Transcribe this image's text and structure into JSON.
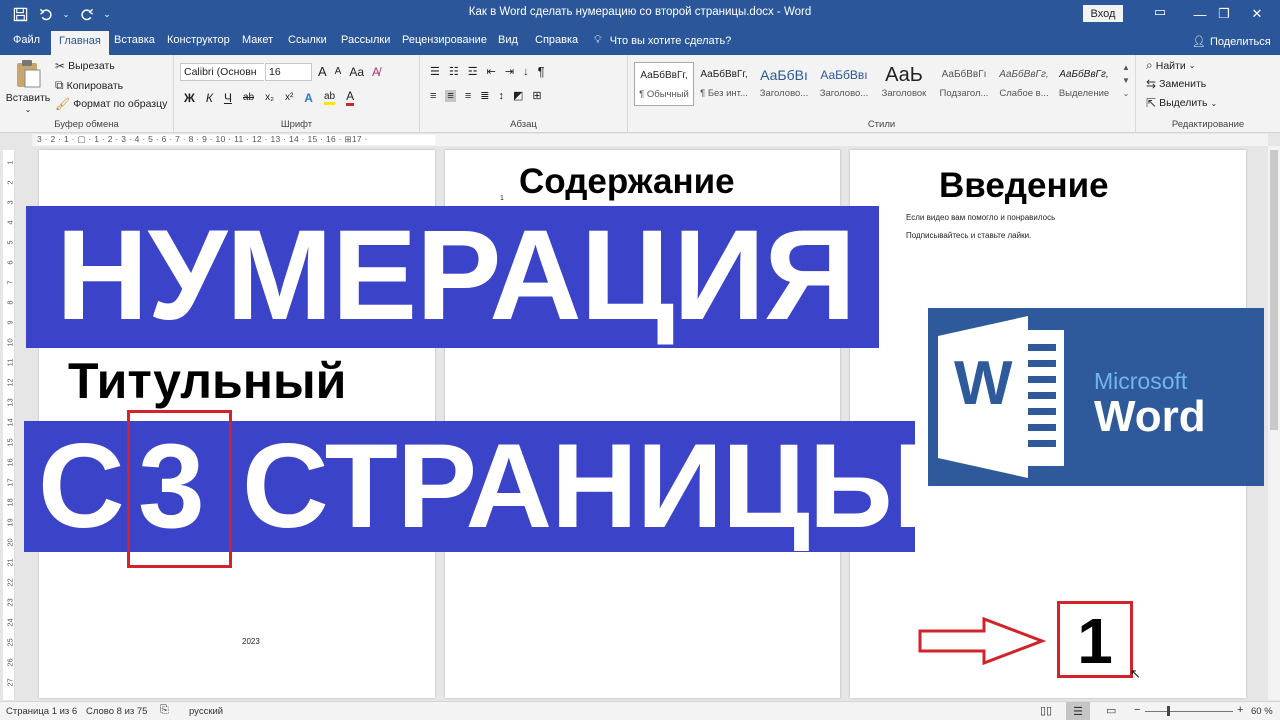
{
  "window": {
    "title": "Как в Word сделать нумерацию со второй страницы.docx  -  Word",
    "signin": "Вход",
    "minimize": "—",
    "restore": "❐",
    "close": "✕"
  },
  "tabs": {
    "items": [
      "Файл",
      "Главная",
      "Вставка",
      "Конструктор",
      "Макет",
      "Ссылки",
      "Рассылки",
      "Рецензирование",
      "Вид",
      "Справка"
    ],
    "tell_me": "Что вы хотите сделать?",
    "share": "Поделиться"
  },
  "ribbon": {
    "clipboard": {
      "paste": "Вставить",
      "cut": "Вырезать",
      "copy": "Копировать",
      "format_painter": "Формат по образцу",
      "label": "Буфер обмена"
    },
    "font": {
      "font_name": "Calibri (Основн",
      "font_size": "16",
      "grow": "A",
      "shrink": "A",
      "case": "Aa",
      "bold": "Ж",
      "italic": "К",
      "underline": "Ч",
      "strike": "ab",
      "subscript": "x₂",
      "superscript": "x²",
      "effects": "A",
      "highlight": "ab",
      "color": "A",
      "label": "Шрифт"
    },
    "paragraph": {
      "label": "Абзац",
      "pilcrow": "¶"
    },
    "styles": {
      "items": [
        {
          "preview": "АаБбВвГг,",
          "name": "¶ Обычный"
        },
        {
          "preview": "АаБбВвГг,",
          "name": "¶ Без инт..."
        },
        {
          "preview": "АаБбВı",
          "name": "Заголово..."
        },
        {
          "preview": "АаБбВвı",
          "name": "Заголово..."
        },
        {
          "preview": "АаЬ",
          "name": "Заголовок"
        },
        {
          "preview": "АаБбВвГı",
          "name": "Подзагол..."
        },
        {
          "preview": "АаБбВвГг,",
          "name": "Слабое в..."
        },
        {
          "preview": "АаБбВвГг,",
          "name": "Выделение"
        }
      ],
      "label": "Стили"
    },
    "editing": {
      "find": "Найти",
      "replace": "Заменить",
      "select": "Выделить",
      "label": "Редактирование"
    }
  },
  "ruler": {
    "horizontal": "3 · 2 · 1 · ▢ · 1 · 2 · 3 · 4 · 5 · 6 · 7 · 8 · 9 · 10 · 11 · 12 · 13 · 14 · 15 · 16 · ⊞17 ·",
    "vertical": [
      "1",
      "2",
      "3",
      "4",
      "5",
      "6",
      "7",
      "8",
      "9",
      "10",
      "11",
      "12",
      "13",
      "14",
      "15",
      "16",
      "17",
      "18",
      "19",
      "20",
      "21",
      "22",
      "23",
      "24",
      "25",
      "26",
      "27"
    ]
  },
  "pages": {
    "page1": {
      "year": "2023"
    },
    "page2": {
      "heading": "Содержание",
      "number": "1"
    },
    "page3": {
      "heading": "Введение",
      "line1": "Если видео вам помогло и понравилось",
      "line2": "Подписывайтесь и ставьте лайки."
    }
  },
  "overlay": {
    "banner1": "НУМЕРАЦИЯ",
    "subheading": "Титульный",
    "banner2_prefix": "С",
    "banner2_number": "3",
    "banner2_suffix": "СТРАНИЦЫ",
    "logo_microsoft": "Microsoft",
    "logo_word": "Word",
    "logo_letter": "W",
    "page_number": "1"
  },
  "status": {
    "page": "Страница 1 из 6",
    "words": "Слово 8 из 75",
    "language": "русский",
    "zoom": "60 %",
    "zoom_out": "−",
    "zoom_in": "+"
  },
  "colors": {
    "word_blue": "#2b579a",
    "banner_blue": "#3b44c8",
    "highlight_red": "#d1232a"
  }
}
